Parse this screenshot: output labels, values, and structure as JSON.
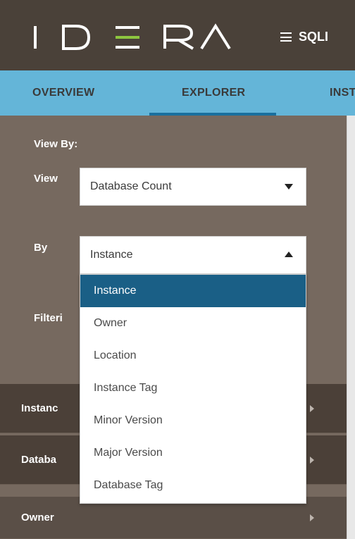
{
  "header": {
    "logo_text": "IDERA",
    "product": "SQLI",
    "colors": {
      "bar": "#4a4139",
      "logo": "#ffffff",
      "logo_accent": "#8dc63f"
    }
  },
  "tabs": [
    {
      "label": "OVERVIEW",
      "active": false
    },
    {
      "label": "EXPLORER",
      "active": true
    },
    {
      "label": "INST",
      "active": false
    }
  ],
  "view_by": {
    "heading": "View By:",
    "view_label": "View",
    "view_value": "Database Count",
    "by_label": "By",
    "by_value": "Instance",
    "filtering_label": "Filteri"
  },
  "by_dropdown": {
    "options": [
      "Instance",
      "Owner",
      "Location",
      "Instance Tag",
      "Minor Version",
      "Major Version",
      "Database Tag"
    ],
    "selected": "Instance"
  },
  "groups": [
    {
      "label": "Instanc"
    },
    {
      "label": "Databa"
    },
    {
      "label": "Owner"
    }
  ],
  "colors": {
    "panel": "#76695f",
    "tab_bar": "#64b5d8",
    "selected_option": "#1a5f86"
  }
}
